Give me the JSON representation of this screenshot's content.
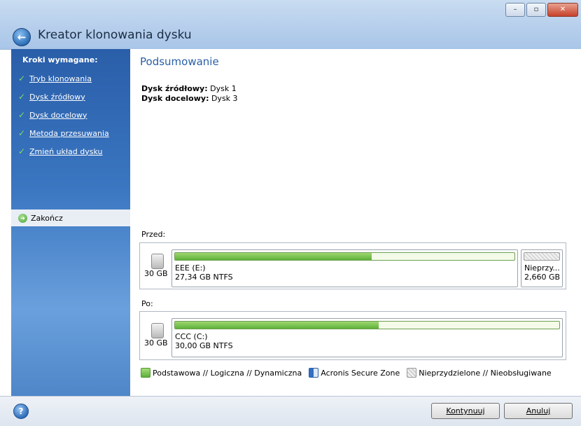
{
  "window": {
    "minimize": "–",
    "maximize": "▫",
    "close": "✕"
  },
  "header": {
    "title": "Kreator klonowania dysku",
    "back_icon": "back-arrow-icon"
  },
  "sidebar": {
    "heading": "Kroki wymagane:",
    "steps": [
      {
        "label": "Tryb klonowania",
        "done": true
      },
      {
        "label": "Dysk źródłowy",
        "done": true
      },
      {
        "label": "Dysk docelowy",
        "done": true
      },
      {
        "label": "Metoda przesuwania",
        "done": true
      },
      {
        "label": "Zmień układ dysku",
        "done": true
      }
    ],
    "current": "Zakończ"
  },
  "main": {
    "title": "Podsumowanie",
    "source_label": "Dysk źródłowy:",
    "source_value": " Dysk 1",
    "target_label": "Dysk docelowy:",
    "target_value": " Dysk 3",
    "before_label": "Przed:",
    "after_label": "Po:",
    "before_disk": {
      "size": "30 GB",
      "partition": {
        "name": "EEE (E:)",
        "info": "27,34 GB  NTFS",
        "used_fraction": 0.58
      },
      "unallocated": {
        "name": "Nieprzy...",
        "info": "2,660 GB"
      }
    },
    "after_disk": {
      "size": "30 GB",
      "partition": {
        "name": "CCC (C:)",
        "info": "30,00 GB  NTFS",
        "used_fraction": 0.53
      }
    },
    "legend": [
      {
        "label": "Podstawowa // Logiczna // Dynamiczna",
        "type": "basic"
      },
      {
        "label": "Acronis Secure Zone",
        "type": "asz"
      },
      {
        "label": "Nieprzydzielone // Nieobsługiwane",
        "type": "unalloc"
      }
    ]
  },
  "footer": {
    "help_icon": "?",
    "continue_label": "Kontynuuj",
    "cancel_label": "Anuluj"
  },
  "colors": {
    "accent": "#2a5fa6",
    "partition_fill": "#5db03a",
    "sidebar": "#3a76c1"
  }
}
